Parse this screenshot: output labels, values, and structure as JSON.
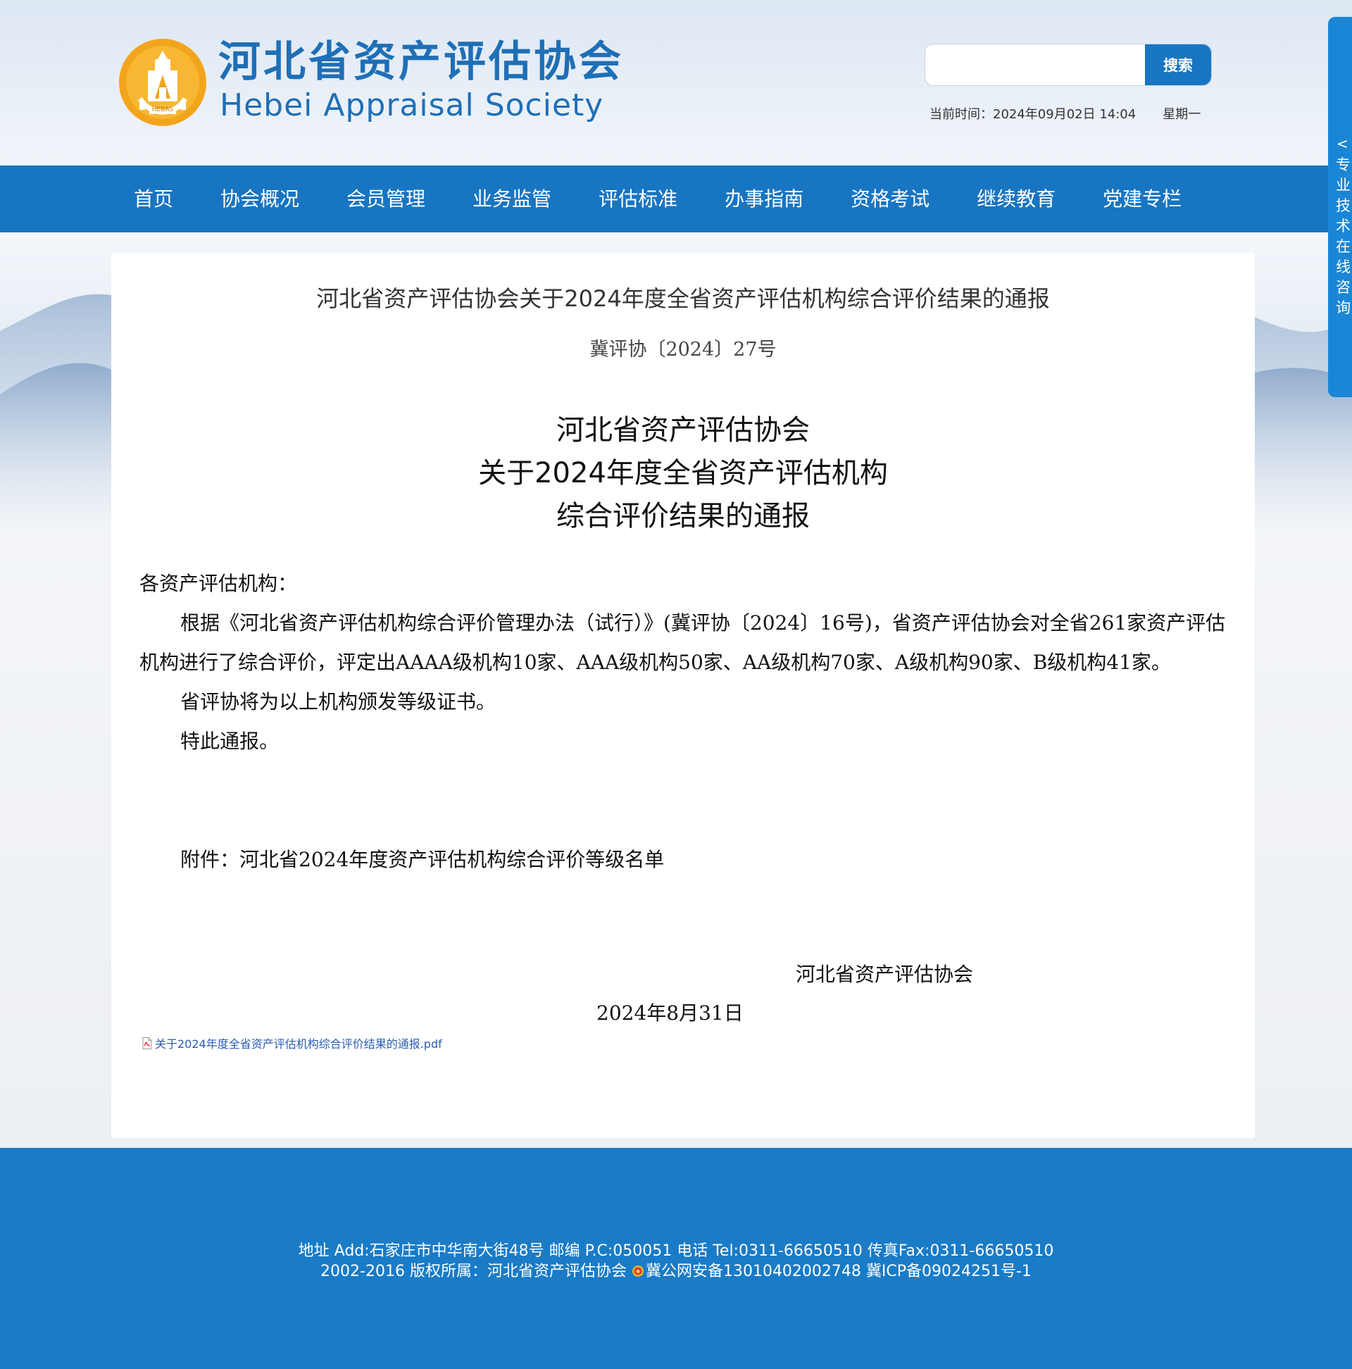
{
  "header": {
    "logo_cn": "河北省资产评估协会",
    "logo_en": "Hebei Appraisal Society",
    "emblem_text": "HEBAS",
    "emblem_arc_text": "河北资产评估",
    "search_placeholder": "",
    "search_button": "搜索",
    "time_label": "当前时间：",
    "time_value": "2024年09月02日 14:04",
    "weekday": "星期一"
  },
  "nav": {
    "items": [
      "首页",
      "协会概况",
      "会员管理",
      "业务监管",
      "评估标准",
      "办事指南",
      "资格考试",
      "继续教育",
      "党建专栏"
    ]
  },
  "float_tab": {
    "arrow": "<",
    "label": "专业技术在线咨询"
  },
  "article": {
    "title": "河北省资产评估协会关于2024年度全省资产评估机构综合评价结果的通报",
    "doc_number": "冀评协〔2024〕27号",
    "heading_lines": [
      "河北省资产评估协会",
      "关于2024年度全省资产评估机构",
      "综合评价结果的通报"
    ],
    "salutation": "各资产评估机构：",
    "paragraphs": [
      "根据《河北省资产评估机构综合评价管理办法（试行）》(冀评协〔2024〕16号)，省资产评估协会对全省261家资产评估机构进行了综合评价，评定出AAAA级机构10家、AAA级机构50家、AA级机构70家、A级机构90家、B级机构41家。",
      "省评协将为以上机构颁发等级证书。",
      "特此通报。"
    ],
    "attachment": "附件：河北省2024年度资产评估机构综合评价等级名单",
    "signature_org": "河北省资产评估协会",
    "signature_date": "2024年8月31日",
    "pdf_link": "关于2024年度全省资产评估机构综合评价结果的通报.pdf"
  },
  "footer": {
    "line1": "地址 Add:石家庄市中华南大街48号 邮编 P.C:050051 电话 Tel:0311-66650510 传真Fax:0311-66650510",
    "line2_prefix": "2002-2016 版权所属：河北省资产评估协会 ",
    "line2_suffix": "冀公网安备13010402002748 冀ICP备09024251号-1"
  },
  "colors": {
    "primary_blue": "#1875c2",
    "footer_blue": "#1a7bc7",
    "logo_blue": "#1f6fb6",
    "emblem_orange": "#f2a51c",
    "link_blue": "#2a5db0"
  }
}
